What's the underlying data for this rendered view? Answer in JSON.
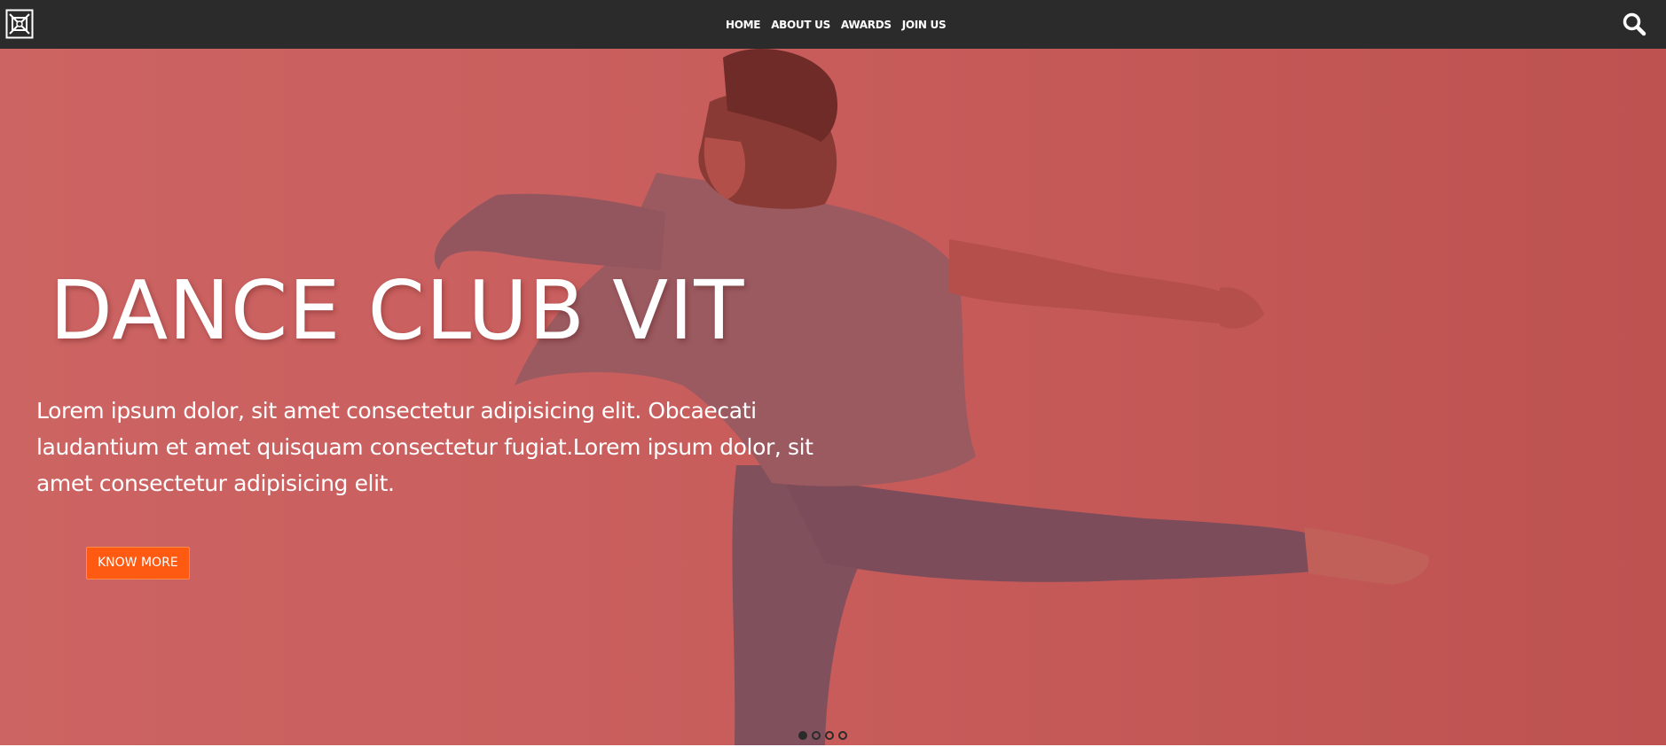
{
  "nav": {
    "logo_icon": "logo-icon",
    "links": [
      "HOME",
      "ABOUT US",
      "AWARDS",
      "JOIN US"
    ],
    "search_icon": "search-icon"
  },
  "hero": {
    "title": "DANCE CLUB VIT",
    "text": "Lorem ipsum dolor, sit amet consectetur adipisicing elit. Obcaecati laudantium et amet quisquam consectetur fugiat.Lorem ipsum dolor, sit amet consectetur adipisicing elit.",
    "button_label": "KNOW MORE",
    "overlay_color": "#c85d5c",
    "button_color": "#ff5a12"
  },
  "carousel": {
    "slide_count": 4,
    "active_index": 0
  }
}
